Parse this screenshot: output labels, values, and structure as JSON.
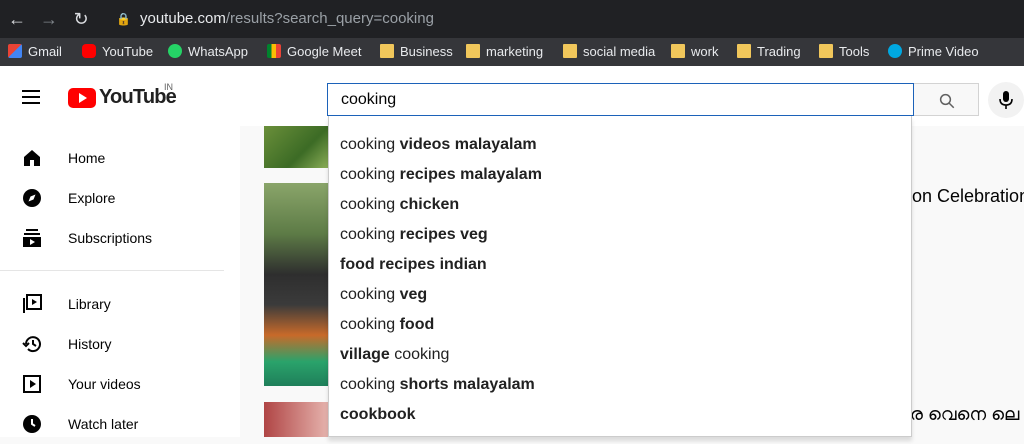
{
  "browser": {
    "url_host": "youtube.com",
    "url_path": "/results?search_query=cooking",
    "bookmarks": [
      {
        "label": "Gmail",
        "icon": "gmail-icon"
      },
      {
        "label": "YouTube",
        "icon": "youtube-icon"
      },
      {
        "label": "WhatsApp",
        "icon": "whatsapp-icon"
      },
      {
        "label": "Google Meet",
        "icon": "google-meet-icon"
      },
      {
        "label": "Business",
        "icon": "folder-icon"
      },
      {
        "label": "marketing",
        "icon": "folder-icon"
      },
      {
        "label": "social media",
        "icon": "folder-icon"
      },
      {
        "label": "work",
        "icon": "folder-icon"
      },
      {
        "label": "Trading",
        "icon": "folder-icon"
      },
      {
        "label": "Tools",
        "icon": "folder-icon"
      },
      {
        "label": "Prime Video",
        "icon": "prime-video-icon"
      }
    ]
  },
  "header": {
    "logo_text": "YouTube",
    "country_code": "IN",
    "search_value": "cooking"
  },
  "sidebar": {
    "items": [
      {
        "label": "Home",
        "icon": "home-icon"
      },
      {
        "label": "Explore",
        "icon": "compass-icon"
      },
      {
        "label": "Subscriptions",
        "icon": "subscriptions-icon"
      },
      {
        "label": "Library",
        "icon": "library-icon"
      },
      {
        "label": "History",
        "icon": "history-icon"
      },
      {
        "label": "Your videos",
        "icon": "your-videos-icon"
      },
      {
        "label": "Watch later",
        "icon": "clock-icon"
      }
    ]
  },
  "suggestions": [
    {
      "pre": "cooking",
      "bold": " videos malayalam",
      "post": ""
    },
    {
      "pre": "cooking",
      "bold": " recipes malayalam",
      "post": ""
    },
    {
      "pre": "cooking",
      "bold": " chicken",
      "post": ""
    },
    {
      "pre": "cooking",
      "bold": " recipes veg",
      "post": ""
    },
    {
      "pre": "",
      "bold": "food recipes indian",
      "post": ""
    },
    {
      "pre": "cooking",
      "bold": " veg",
      "post": ""
    },
    {
      "pre": "cooking",
      "bold": " food",
      "post": ""
    },
    {
      "pre": "",
      "bold": "village",
      "post": " cooking"
    },
    {
      "pre": "cooking",
      "bold": " shorts malayalam",
      "post": ""
    },
    {
      "pre": "",
      "bold": "cookbook",
      "post": ""
    }
  ],
  "results": {
    "title_1_fragment": "on Celebration",
    "title_2_fragment": "ര വെനെ ലെ"
  },
  "colors": {
    "accent_blue": "#1c62b9",
    "youtube_red": "#ff0000"
  }
}
